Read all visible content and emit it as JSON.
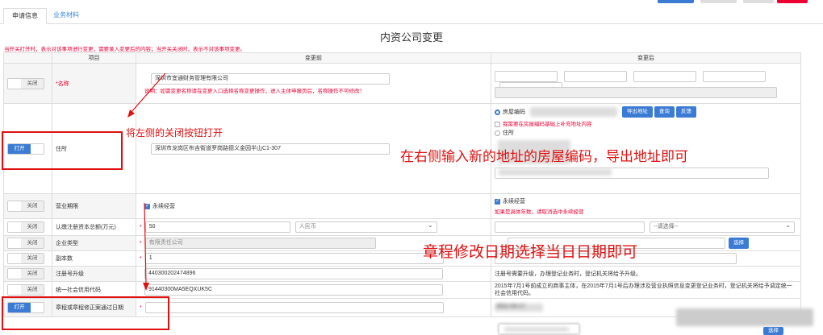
{
  "tabs": [
    {
      "label": "申请信息"
    },
    {
      "label": "业务材料"
    }
  ],
  "title": "内资公司变更",
  "note": "当开关打开时，表示对该事项进行变更，需要录入变更后的内容；当开关关闭时，表示不对该事项变更。",
  "header": {
    "item": "项目",
    "before": "变更前",
    "after": "变更后"
  },
  "toggle": {
    "off": "关闭",
    "on": "打开"
  },
  "rows": {
    "name": {
      "label": "*名称",
      "before_value": "深圳市宜通财务管理有限公司",
      "before_note": "说明：如需变更名称请在变更入口选择名称变更操作，进入主体申报页后，名称操作不可修改！"
    },
    "address": {
      "label": "住所",
      "before_value": "深圳市龙岗区布吉街道罗岗路德义金园半山C1-307",
      "radio_house_code": "房屋编码",
      "btn_export": "导出地址",
      "btn_query": "查询",
      "btn_feedback": "反馈",
      "checkbox_text": "我需要在房屋编码基础上补充地址内容",
      "radio_address": "住所"
    },
    "term": {
      "label": "营业期限",
      "before_check": "永续经营",
      "after_check": "永续经营",
      "after_note": "如果是具体年数，请取消选中永续经营"
    },
    "capital": {
      "label": "认缴注册资本总额(万元)",
      "before_value": "50",
      "currency": "人民币",
      "after_placeholder": "--请选择--"
    },
    "type": {
      "label": "企业类型",
      "before_value": "有限责任公司",
      "btn_select": "选择"
    },
    "copies": {
      "label": "副本数",
      "before_value": "1"
    },
    "regno": {
      "label": "注册号升级",
      "before_value": "440300202474896",
      "after_text": "注册号需要升级，办理登记业务时，登记机关将给予升级。"
    },
    "credit": {
      "label": "统一社会信用代码",
      "before_value": "91440300MA5EQXUK5C",
      "after_text": "2015年7月1号前成立的商事主体，在2015年7月1号后办理涉及营业执照信息变更登记业务时，登记机关将给予调定统一社会信用代码。"
    },
    "charter": {
      "label": "章程或章程修正案通过日期",
      "after_date": "2021-03-17"
    }
  },
  "annotations": {
    "a1": "将左侧的关闭按钮打开",
    "a2": "在右侧输入新的地址的房屋编码，导出地址即可",
    "a3": "章程修改日期选择当日日期即可"
  },
  "colors": {
    "accent": "#3b7bd4",
    "annotation": "#e01010",
    "required": "#ee0033"
  }
}
